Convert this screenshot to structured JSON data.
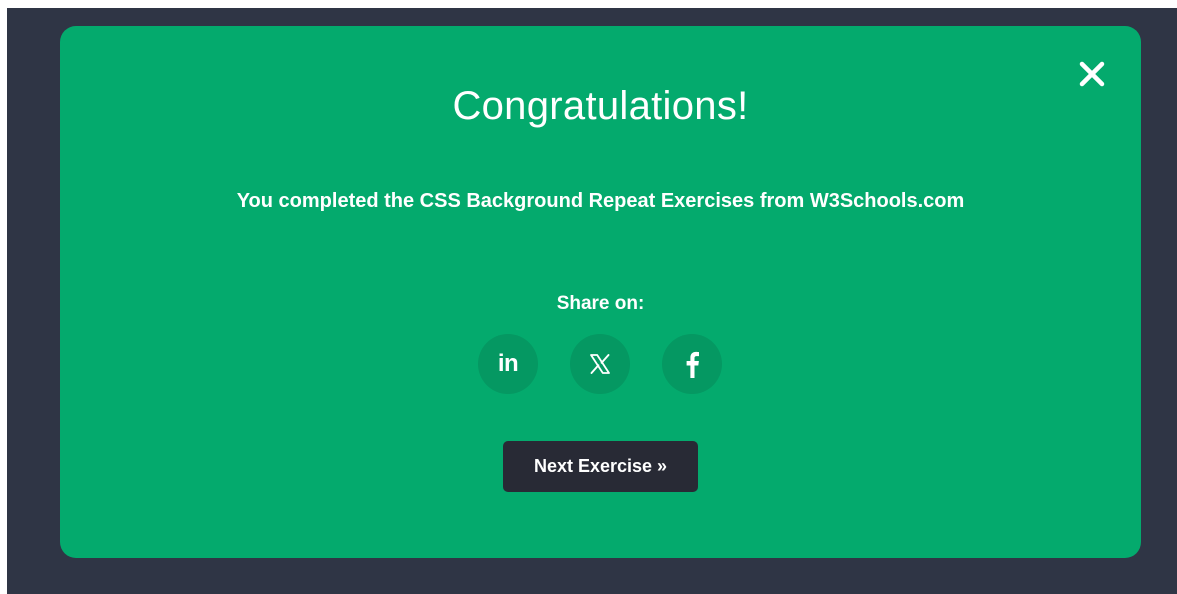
{
  "modal": {
    "title": "Congratulations!",
    "message": "You completed the CSS Background Repeat Exercises from W3Schools.com",
    "share_label": "Share on:",
    "share_buttons": [
      {
        "network": "linkedin",
        "icon": "linkedin-icon",
        "glyph": "in"
      },
      {
        "network": "x",
        "icon": "x-icon"
      },
      {
        "network": "facebook",
        "icon": "facebook-icon"
      }
    ],
    "next_button_label": "Next Exercise »",
    "close_icon": "close-icon"
  },
  "colors": {
    "backdrop": "#2f3545",
    "modal_bg": "#04aa6d",
    "share_button_bg": "#059862",
    "next_button_bg": "#282a35",
    "text": "#ffffff"
  }
}
